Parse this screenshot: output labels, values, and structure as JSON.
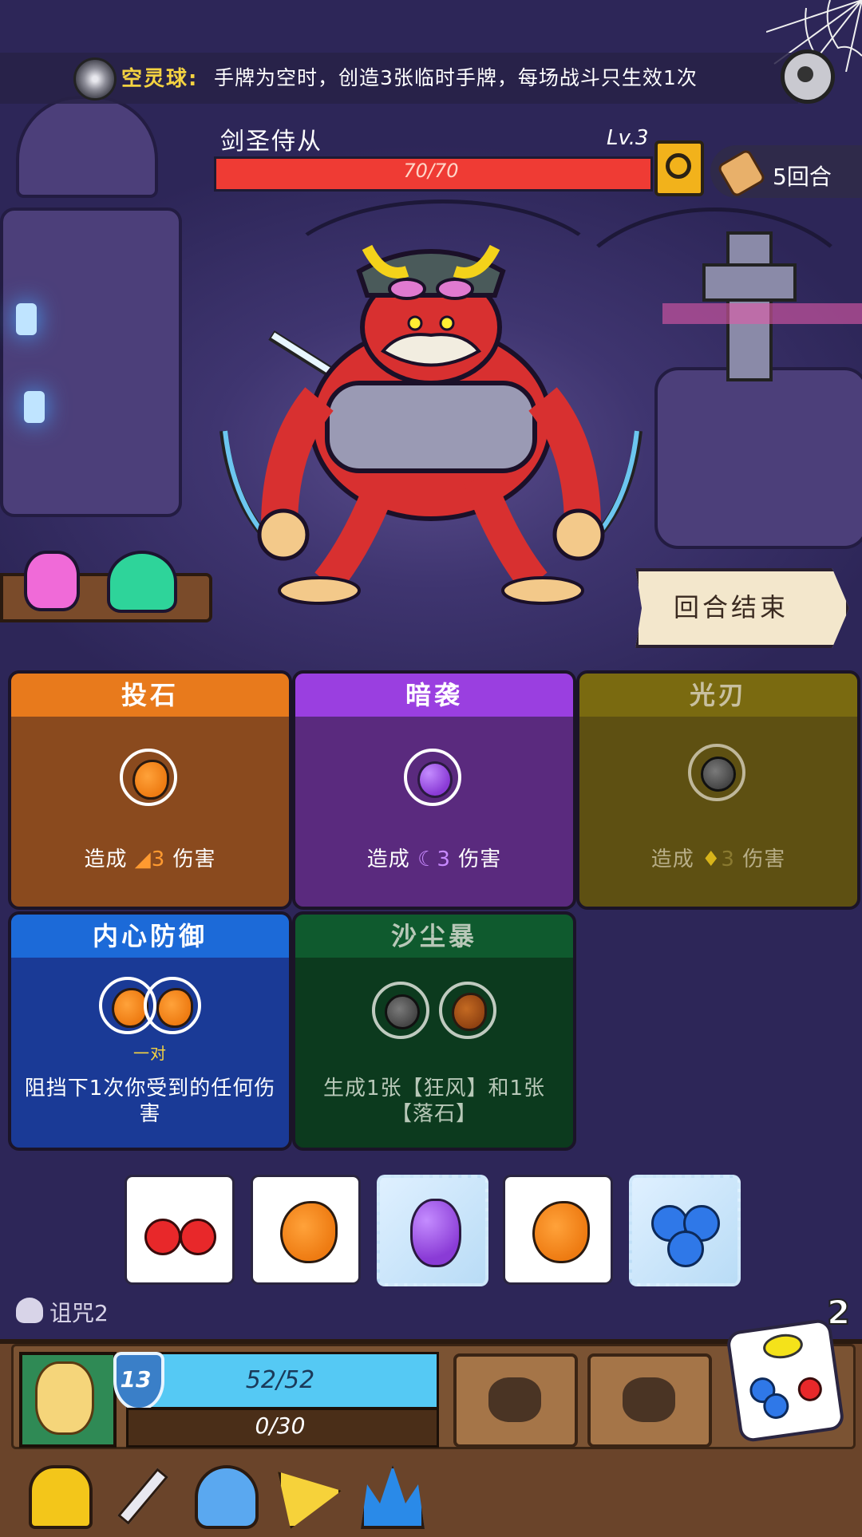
{
  "ability": {
    "name": "空灵球:",
    "description": "手牌为空时，创造3张临时手牌，每场战斗只生效1次"
  },
  "enemy": {
    "name": "剑圣侍从",
    "level": "Lv.3",
    "hp_text": "70/70",
    "hp_current": 70,
    "hp_max": 70
  },
  "turns": "5回合",
  "end_turn_button": "回合结束",
  "cards": [
    {
      "title": "投石",
      "effect_prefix": "造成",
      "effect_value": "3",
      "effect_suffix": "伤害",
      "color": "#e87a1c"
    },
    {
      "title": "暗袭",
      "effect_prefix": "造成",
      "effect_value": "3",
      "effect_suffix": "伤害",
      "color": "#9a3fe0"
    },
    {
      "title": "光刃",
      "effect_prefix": "造成",
      "effect_value": "3",
      "effect_suffix": "伤害",
      "color": "#7a6a10"
    },
    {
      "title": "内心防御",
      "requirement": "一对",
      "description": "阻挡下1次你受到的任何伤害",
      "color": "#1c6ad8"
    },
    {
      "title": "沙尘暴",
      "description": "生成1张【狂风】和1张【落石】",
      "color": "#0f5a2e"
    }
  ],
  "dice": [
    {
      "face": "cherry",
      "frozen": false
    },
    {
      "face": "orange",
      "frozen": false
    },
    {
      "face": "grape",
      "frozen": true
    },
    {
      "face": "orange",
      "frozen": false
    },
    {
      "face": "blueberry",
      "frozen": true
    }
  ],
  "curse": "诅咒2",
  "dice_remaining": "2",
  "player": {
    "shield": "13",
    "hp_text": "52/52",
    "exp_text": "0/30",
    "hp_current": 52,
    "hp_max": 52
  },
  "skills": [
    "punch-skill-icon",
    "dig-skill-icon"
  ],
  "toolbar_icons": [
    "helmet-icon",
    "sword-icon",
    "mushroom-icon",
    "cheese-icon",
    "crown-icon"
  ]
}
